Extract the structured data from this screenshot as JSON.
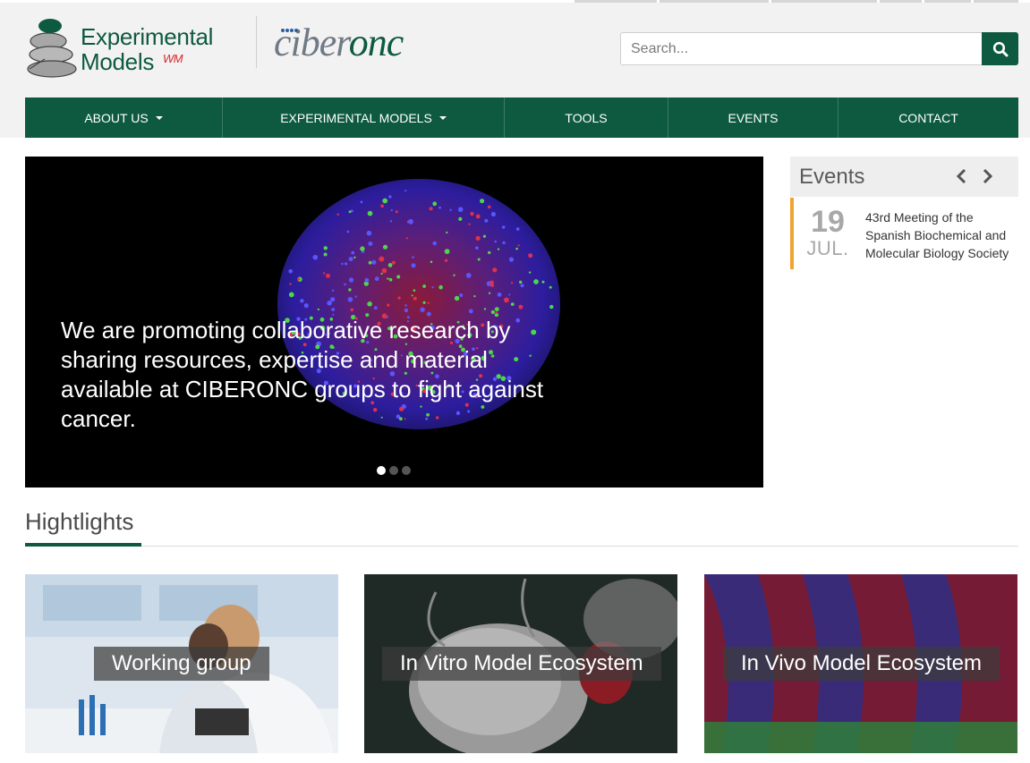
{
  "brand": {
    "logo_line1": "Experimental",
    "logo_line2": "Models",
    "logo_mark": "WM",
    "partner_prefix": "ciber",
    "partner_suffix": "onc"
  },
  "search": {
    "placeholder": "Search..."
  },
  "nav": {
    "items": [
      {
        "label": "ABOUT US"
      },
      {
        "label": "EXPERIMENTAL MODELS"
      },
      {
        "label": "TOOLS"
      },
      {
        "label": "EVENTS"
      },
      {
        "label": "CONTACT"
      }
    ]
  },
  "hero": {
    "text": "We are promoting collaborative research by sharing resources, expertise and material available at CIBERONC groups to fight against cancer.",
    "slide_count": 3,
    "active_slide": 1
  },
  "events": {
    "title": "Events",
    "items": [
      {
        "day": "19",
        "month": "JUL.",
        "title": "43rd Meeting of the Spanish Biochemical and Molecular Biology Society"
      }
    ]
  },
  "highlights": {
    "title": "Hightlights",
    "cards": [
      {
        "label": "Working group"
      },
      {
        "label": "In Vitro Model Ecosystem"
      },
      {
        "label": "In Vivo Model Ecosystem"
      }
    ]
  },
  "colors": {
    "brand_green": "#0e5a40",
    "accent_orange": "#f0a32f",
    "logo_red": "#d9242b"
  }
}
